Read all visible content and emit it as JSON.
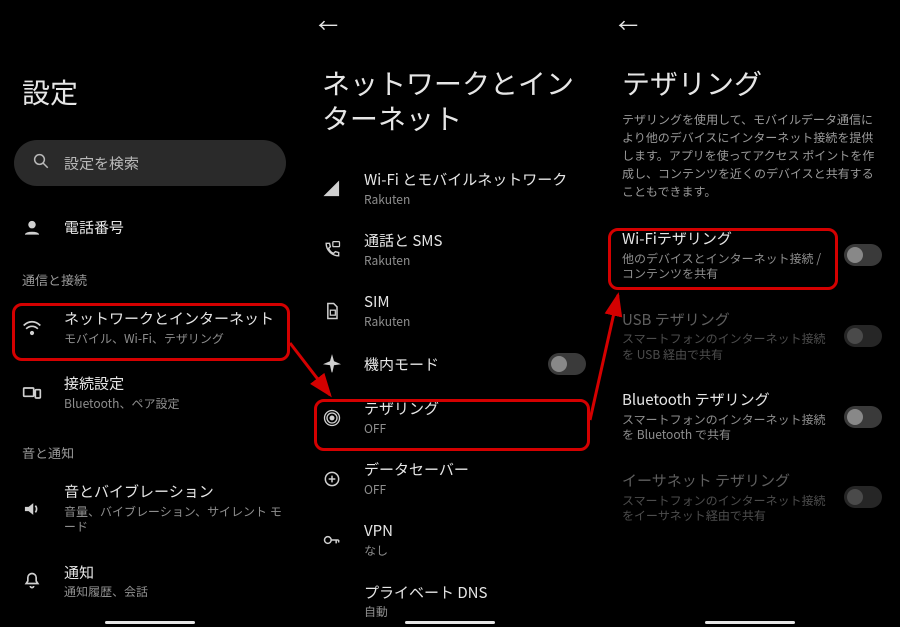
{
  "panel1": {
    "title": "設定",
    "search_placeholder": "設定を検索",
    "phone_label": "電話番号",
    "section_connect": "通信と接続",
    "network": {
      "label": "ネットワークとインターネット",
      "sub": "モバイル、Wi-Fi、テザリング"
    },
    "connected": {
      "label": "接続設定",
      "sub": "Bluetooth、ペア設定"
    },
    "section_sound": "音と通知",
    "sound": {
      "label": "音とバイブレーション",
      "sub": "音量、バイブレーション、サイレント モード"
    },
    "notification": {
      "label": "通知",
      "sub": "通知履歴、会話"
    }
  },
  "panel2": {
    "title": "ネットワークとインターネット",
    "wifi": {
      "label": "Wi-Fi とモバイルネットワーク",
      "sub": "Rakuten"
    },
    "calls": {
      "label": "通話と SMS",
      "sub": "Rakuten"
    },
    "sim": {
      "label": "SIM",
      "sub": "Rakuten"
    },
    "airplane": {
      "label": "機内モード"
    },
    "tethering": {
      "label": "テザリング",
      "sub": "OFF"
    },
    "datasaver": {
      "label": "データセーバー",
      "sub": "OFF"
    },
    "vpn": {
      "label": "VPN",
      "sub": "なし"
    },
    "privatedns": {
      "label": "プライベート DNS",
      "sub": "自動"
    }
  },
  "panel3": {
    "title": "テザリング",
    "description": "テザリングを使用して、モバイルデータ通信により他のデバイスにインターネット接続を提供します。アプリを使ってアクセス ポイントを作成し、コンテンツを近くのデバイスと共有することもできます。",
    "wifitether": {
      "label": "Wi-Fiテザリング",
      "sub": "他のデバイスとインターネット接続 / コンテンツを共有"
    },
    "usbtether": {
      "label": "USB テザリング",
      "sub": "スマートフォンのインターネット接続を USB 経由で共有"
    },
    "bttether": {
      "label": "Bluetooth テザリング",
      "sub": "スマートフォンのインターネット接続を Bluetooth で共有"
    },
    "ethertether": {
      "label": "イーサネット テザリング",
      "sub": "スマートフォンのインターネット接続をイーサネット経由で共有"
    }
  }
}
